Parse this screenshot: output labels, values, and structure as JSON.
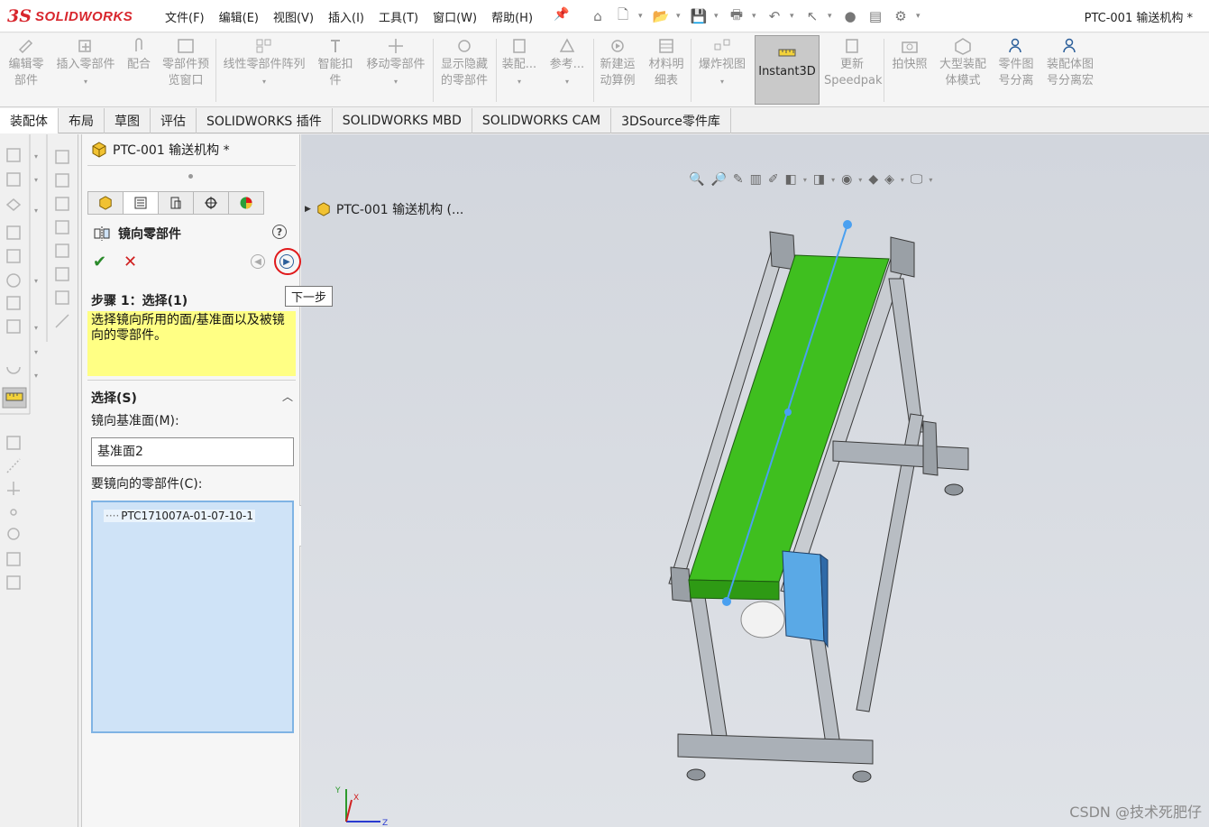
{
  "app": {
    "brand_prefix": "3S",
    "brand_name": "SOLIDWORKS",
    "document_title": "PTC-001 输送机构 *"
  },
  "menu": [
    "文件(F)",
    "编辑(E)",
    "视图(V)",
    "插入(I)",
    "工具(T)",
    "窗口(W)",
    "帮助(H)"
  ],
  "ribbon": {
    "edit_component": [
      "编辑零",
      "部件"
    ],
    "insert_components": "插入零部件",
    "mate": "配合",
    "component_preview": [
      "零部件预",
      "览窗口"
    ],
    "linear_pattern": "线性零部件阵列",
    "smart_fasteners": [
      "智能扣",
      "件"
    ],
    "move_component": "移动零部件",
    "show_hidden": [
      "显示隐藏",
      "的零部件"
    ],
    "assembly_features": "装配...",
    "reference": "参考...",
    "new_motion_study": [
      "新建运",
      "动算例"
    ],
    "bill_of_materials": [
      "材料明",
      "细表"
    ],
    "exploded_view": "爆炸视图",
    "instant3d": "Instant3D",
    "update_speedpak": [
      "更新",
      "Speedpak"
    ],
    "take_snapshot": "拍快照",
    "large_assembly_mode": [
      "大型装配",
      "体模式"
    ],
    "part_drawing_sep": [
      "零件图",
      "号分离"
    ],
    "assembly_drawing_sep": [
      "装配体图",
      "号分离宏"
    ]
  },
  "tabs": [
    "装配体",
    "布局",
    "草图",
    "评估",
    "SOLIDWORKS 插件",
    "SOLIDWORKS MBD",
    "SOLIDWORKS CAM",
    "3DSource零件库"
  ],
  "active_tab": "装配体",
  "pm": {
    "header_title": "PTC-001 输送机构 *",
    "feature_title": "镜向零部件",
    "help": "?",
    "tooltip_next": "下一步",
    "step_heading": "步骤 1：选择(1)",
    "step_message": "选择镜向所用的面/基准面以及被镜向的零部件。",
    "selections_heading": "选择(S)",
    "mirror_plane_label": "镜向基准面(M):",
    "mirror_plane_value": "基准面2",
    "components_label": "要镜向的零部件(C):",
    "components": [
      "PTC171007A-01-07-10-1"
    ]
  },
  "viewport": {
    "tree_root": "PTC-001 输送机构 (...",
    "watermark": "CSDN @技术死肥仔",
    "triad": {
      "x": "X",
      "y": "Y",
      "z": "Z"
    }
  },
  "colors": {
    "belt": "#3fbf1f",
    "frame": "#9aa0a6",
    "motor_box": "#5aa9e6",
    "highlight_circle": "#e0191b",
    "step_box": "#ffff84"
  }
}
